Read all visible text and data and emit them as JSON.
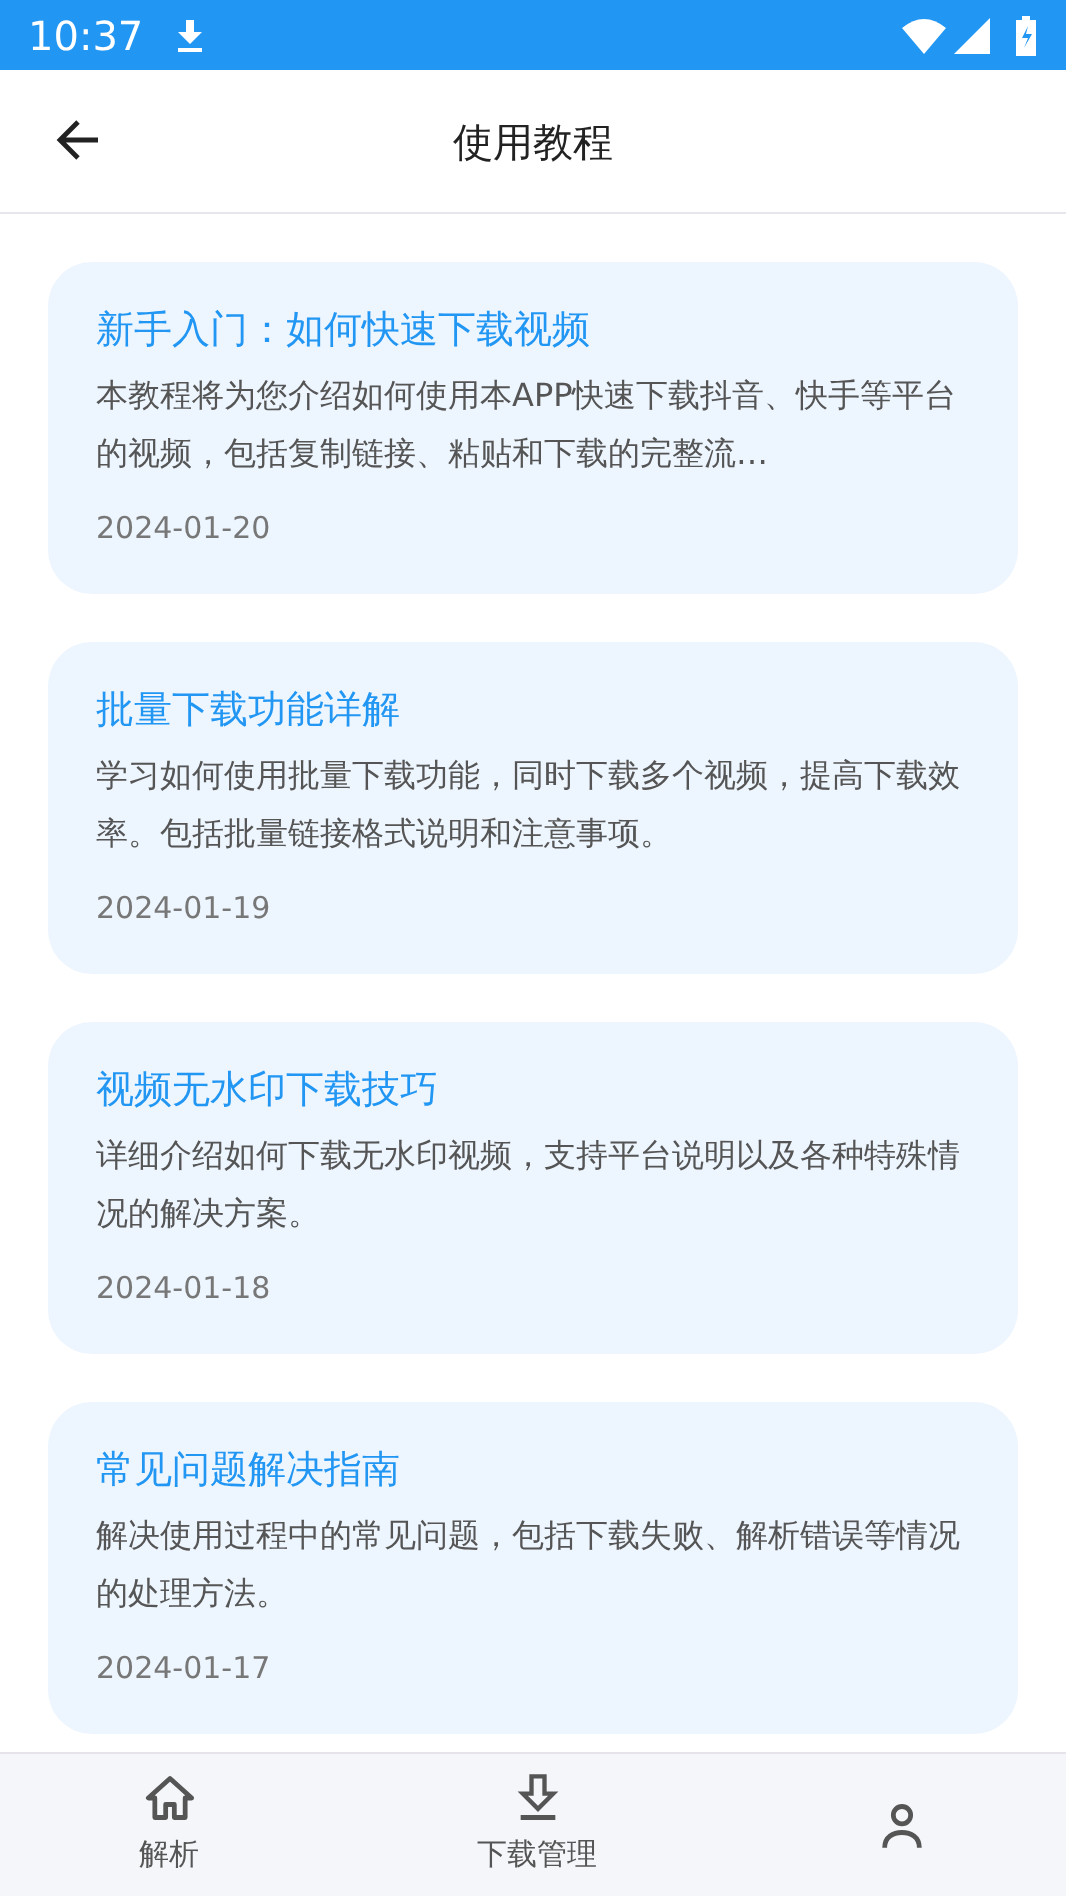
{
  "status_bar": {
    "time": "10:37"
  },
  "header": {
    "title": "使用教程"
  },
  "articles": [
    {
      "title": "新手入门：如何快速下载视频",
      "summary": "本教程将为您介绍如何使用本APP快速下载抖音、快手等平台的视频，包括复制链接、粘贴和下载的完整流…",
      "date": "2024-01-20"
    },
    {
      "title": "批量下载功能详解",
      "summary": "学习如何使用批量下载功能，同时下载多个视频，提高下载效率。包括批量链接格式说明和注意事项。",
      "date": "2024-01-19"
    },
    {
      "title": "视频无水印下载技巧",
      "summary": "详细介绍如何下载无水印视频，支持平台说明以及各种特殊情况的解决方案。",
      "date": "2024-01-18"
    },
    {
      "title": "常见问题解决指南",
      "summary": "解决使用过程中的常见问题，包括下载失败、解析错误等情况的处理方法。",
      "date": "2024-01-17"
    }
  ],
  "bottom_nav": [
    {
      "kind": "home",
      "label": "解析"
    },
    {
      "kind": "download",
      "label": "下载管理"
    },
    {
      "kind": "person"
    }
  ]
}
